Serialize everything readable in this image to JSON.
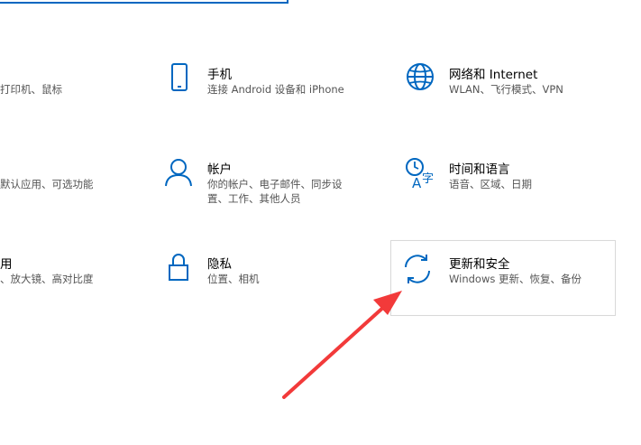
{
  "left_partial": {
    "devices_desc": "打印机、鼠标",
    "apps_desc": "默认应用、可选功能",
    "ease_title": "用",
    "ease_desc": "、放大镜、高对比度"
  },
  "tiles": [
    {
      "title": "手机",
      "desc": "连接 Android 设备和 iPhone"
    },
    {
      "title": "网络和 Internet",
      "desc": "WLAN、飞行模式、VPN"
    },
    {
      "title": "帐户",
      "desc_line1": "你的帐户、电子邮件、同步设",
      "desc_line2": "置、工作、其他人员"
    },
    {
      "title": "时间和语言",
      "desc": "语音、区域、日期"
    },
    {
      "title": "隐私",
      "desc": "位置、相机"
    },
    {
      "title": "更新和安全",
      "desc": "Windows 更新、恢复、备份"
    }
  ],
  "colors": {
    "accent": "#0067c0",
    "annotation_arrow": "#f23a3a"
  },
  "icons": [
    "phone-icon",
    "globe-icon",
    "person-icon",
    "time-language-icon",
    "lock-icon",
    "sync-icon"
  ]
}
